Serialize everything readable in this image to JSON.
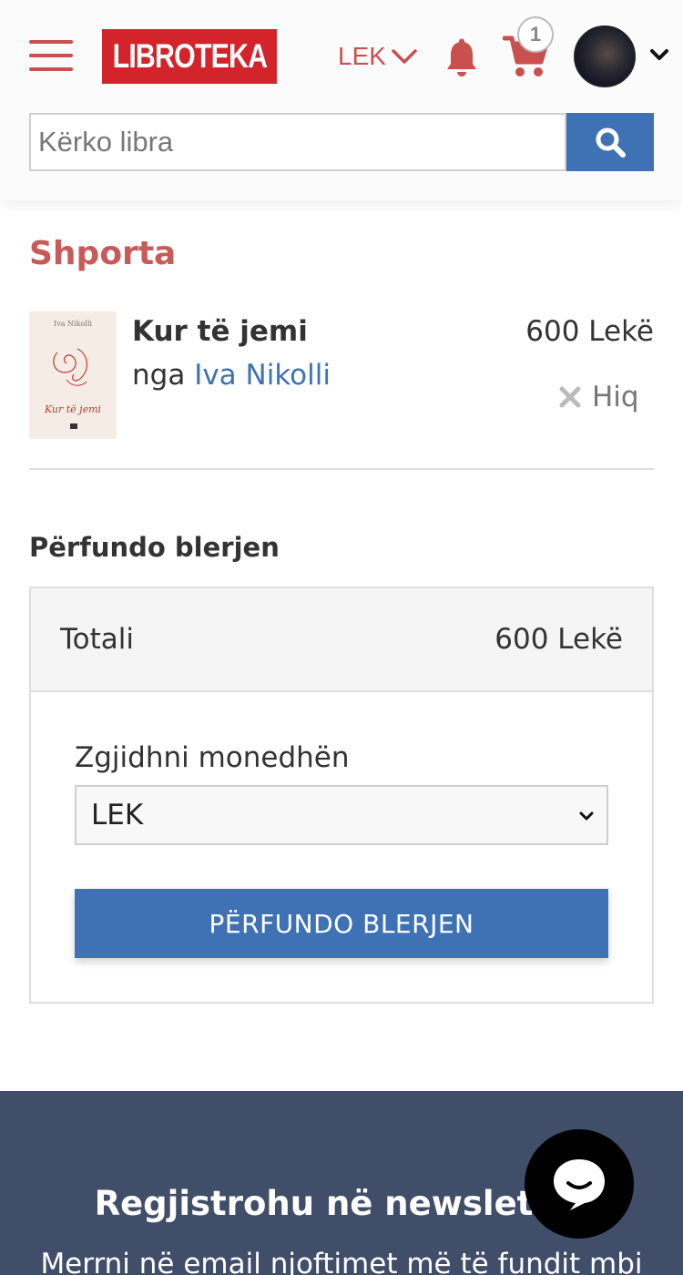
{
  "header": {
    "logo_text": "LIBROTEKA",
    "currency": "LEK",
    "cart_count": "1",
    "search_placeholder": "Kërko libra"
  },
  "cart": {
    "title": "Shporta",
    "items": [
      {
        "title": "Kur të jemi",
        "by_label": "nga",
        "author": "Iva Nikolli",
        "price": "600 Lekë",
        "remove_label": "Hiq",
        "cover_author": "Iva Nikolli",
        "cover_title": "Kur të jemi"
      }
    ]
  },
  "checkout": {
    "title": "Përfundo blerjen",
    "total_label": "Totali",
    "total_value": "600 Lekë",
    "currency_label": "Zgjidhni monedhën",
    "currency_selected": "LEK",
    "button_label": "PËRFUNDO BLERJEN"
  },
  "footer": {
    "newsletter_title": "Regjistrohu në newsletter",
    "newsletter_text": "Merrni në email njoftimet më të fundit mbi"
  },
  "colors": {
    "brand_red": "#d3242c",
    "accent_red": "#c9504e",
    "link_blue": "#3e72b4",
    "footer_bg": "#414e69"
  }
}
